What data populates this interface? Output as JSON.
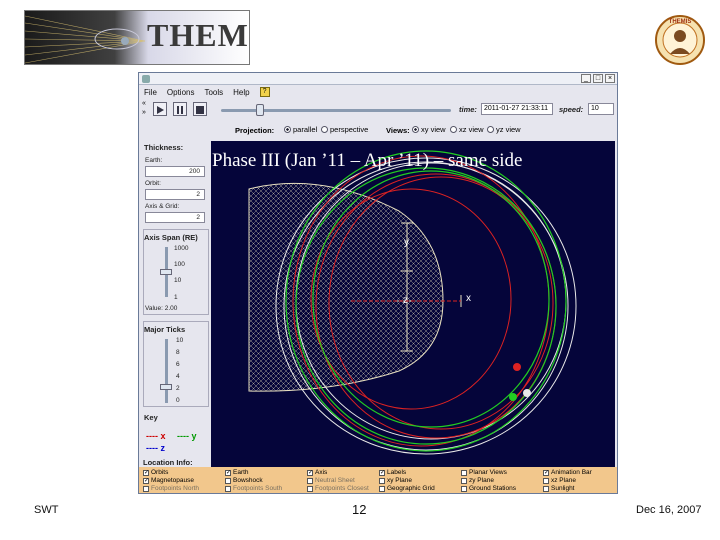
{
  "header": {
    "logo_text": "THEMIS",
    "badge_text": "THEMIS"
  },
  "slide": {
    "title": "Phase III (Jan ’11 – Apr ’11) – same side"
  },
  "window": {
    "menu": [
      "File",
      "Options",
      "Tools",
      "Help"
    ],
    "help_icon": "?",
    "controls": {
      "minimize": "_",
      "maximize": "□",
      "close": "×"
    }
  },
  "playback": {
    "side_arrows": [
      "«",
      "»"
    ],
    "time_label": "time:",
    "time_value": "2011-01-27 21:33:11",
    "speed_label": "speed:",
    "speed_value": "10",
    "slider_fraction": 0.17
  },
  "projection": {
    "label": "Projection:",
    "options": [
      "parallel",
      "perspective"
    ],
    "selected": "parallel",
    "views_label": "Views:",
    "view_options": [
      "xy view",
      "xz view",
      "yz view"
    ],
    "view_selected": "xy view"
  },
  "left_panel": {
    "thickness_label": "Thickness:",
    "fields": [
      {
        "label": "Earth:",
        "value": "200"
      },
      {
        "label": "Orbit:",
        "value": "2"
      },
      {
        "label": "Axis & Grid:",
        "value": "2"
      }
    ],
    "axis_span_label": "Axis Span (RE)",
    "axis_span_ticks": [
      "1000",
      "100",
      "10",
      "1"
    ],
    "axis_span_value": "Value: 2.00",
    "major_ticks_label": "Major Ticks",
    "major_ticks": [
      "10",
      "8",
      "6",
      "4",
      "2",
      "0"
    ],
    "key_label": "Key",
    "key_items": [
      {
        "style": "----",
        "axis": "x",
        "color": "#cc0000"
      },
      {
        "style": "----",
        "axis": "y",
        "color": "#009900"
      },
      {
        "style": "----",
        "axis": "z",
        "color": "#0000cc"
      }
    ]
  },
  "plot": {
    "axis_labels": {
      "x": "x",
      "y": "y",
      "z": "z"
    },
    "colors": {
      "background": "#05053a",
      "magnetopause": "#e8e0c0",
      "red_orbit": "#dd2222",
      "green_orbit": "#22cc22",
      "white_orbit": "#e8e8e8"
    }
  },
  "location_info": {
    "title": "Location Info:",
    "checkboxes": [
      {
        "label": "Orbits",
        "checked": true,
        "dim": false
      },
      {
        "label": "Magnetopause",
        "checked": true,
        "dim": false
      },
      {
        "label": "Footpoints North",
        "checked": false,
        "dim": true
      },
      {
        "label": "Earth",
        "checked": true,
        "dim": false
      },
      {
        "label": "Bowshock",
        "checked": false,
        "dim": false
      },
      {
        "label": "Footpoints South",
        "checked": false,
        "dim": true
      },
      {
        "label": "Axis",
        "checked": true,
        "dim": false
      },
      {
        "label": "Neutral Sheet",
        "checked": false,
        "dim": true
      },
      {
        "label": "Footpoints Closest",
        "checked": false,
        "dim": true
      },
      {
        "label": "Labels",
        "checked": true,
        "dim": false
      },
      {
        "label": "xy Plane",
        "checked": false,
        "dim": false
      },
      {
        "label": "Geographic Grid",
        "checked": false,
        "dim": false
      },
      {
        "label": "Planar Views",
        "checked": false,
        "dim": false
      },
      {
        "label": "zy Plane",
        "checked": false,
        "dim": false
      },
      {
        "label": "Ground Stations",
        "checked": false,
        "dim": false
      },
      {
        "label": "Animation Bar",
        "checked": true,
        "dim": false
      },
      {
        "label": "xz Plane",
        "checked": false,
        "dim": false
      },
      {
        "label": "Sunlight",
        "checked": false,
        "dim": false
      }
    ]
  },
  "footer": {
    "left": "SWT",
    "page": "12",
    "date": "Dec 16, 2007"
  }
}
